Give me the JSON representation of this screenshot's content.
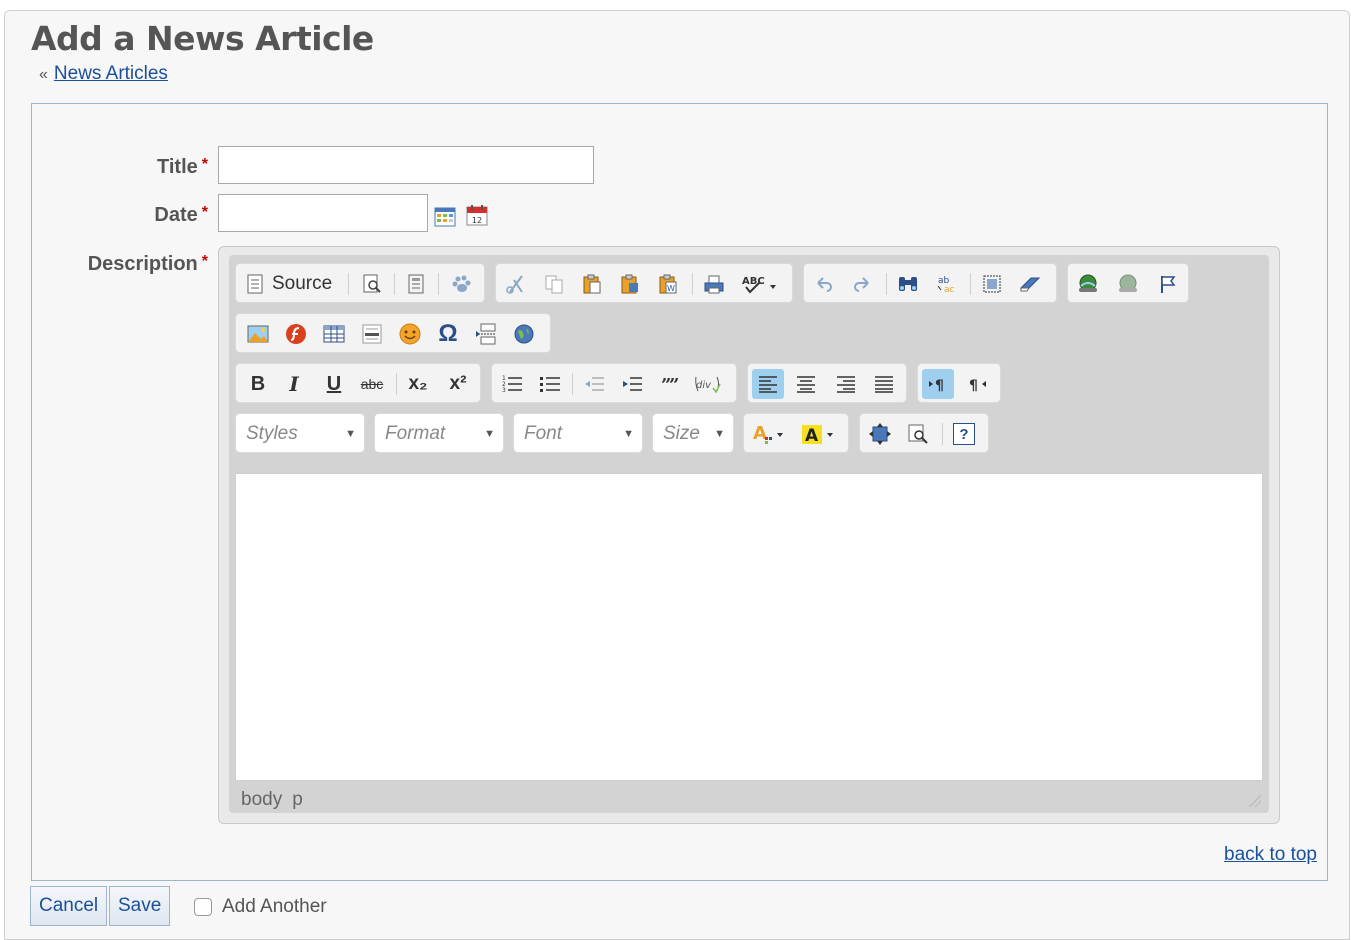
{
  "page": {
    "title": "Add a News Article",
    "breadcrumb_sep": "«",
    "breadcrumb_link": "News Articles"
  },
  "form": {
    "title_label": "Title",
    "date_label": "Date",
    "description_label": "Description",
    "required_mark": "*",
    "title_value": "",
    "date_value": ""
  },
  "editor": {
    "source_label": "Source",
    "combos": {
      "styles": "Styles",
      "format": "Format",
      "font": "Font",
      "size": "Size"
    },
    "bold_glyph": "B",
    "italic_glyph": "I",
    "underline_glyph": "U",
    "strike_glyph": "abc",
    "subscript_glyph": "x₂",
    "superscript_glyph": "x²",
    "special_char_glyph": "Ω",
    "help_glyph": "?",
    "path": [
      "body",
      "p"
    ],
    "content": ""
  },
  "links": {
    "back_to_top": "back to top"
  },
  "buttons": {
    "cancel": "Cancel",
    "save": "Save"
  },
  "add_another": {
    "label": "Add Another",
    "checked": false
  },
  "colors": {
    "link": "#1a4f9c",
    "required": "#cc0000",
    "active_button": "#9ecfef",
    "box_border": "#9fb4cf"
  }
}
